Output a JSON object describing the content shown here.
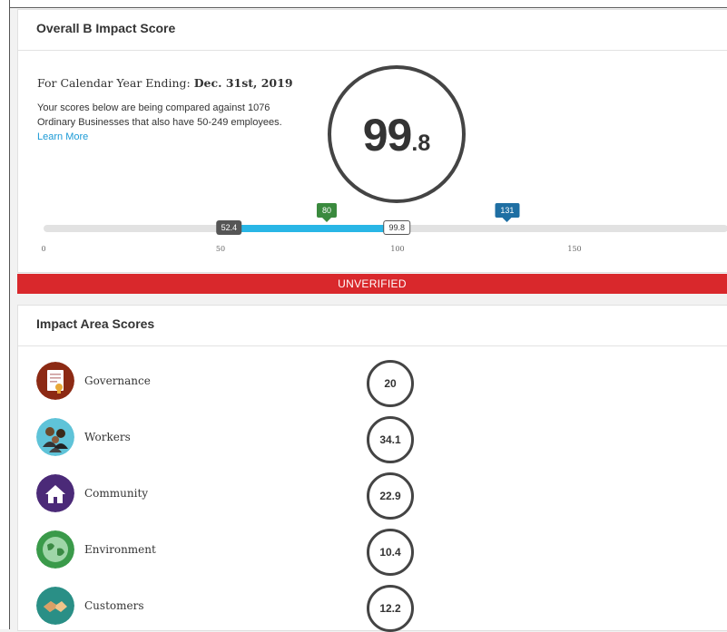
{
  "overall": {
    "title": "Overall B Impact Score",
    "year_prefix": "For Calendar Year Ending: ",
    "year_value": "Dec. 31st, 2019",
    "description": "Your scores below are being compared against 1076 Ordinary Businesses that also have 50-249 employees.",
    "learn_more": "Learn More",
    "score_int": "99",
    "score_dec": ".8"
  },
  "scale": {
    "min": 0,
    "max": 200,
    "fill_from": 52.4,
    "fill_to": 99.8,
    "start_label": "52.4",
    "end_label": "99.8",
    "median_flag": {
      "value": 80,
      "label": "80",
      "color": "#3a8a3e"
    },
    "top_flag": {
      "value": 131,
      "label": "131",
      "color": "#1f6fa3"
    },
    "ticks": [
      "0",
      "50",
      "100",
      "150"
    ],
    "fill_color": "#29b6e6"
  },
  "status_banner": {
    "text": "UNVERIFIED",
    "color": "#d9282c"
  },
  "impact": {
    "title": "Impact Area Scores",
    "areas": [
      {
        "label": "Governance",
        "score": "20",
        "icon": "governance-icon",
        "color": "#8c2a14"
      },
      {
        "label": "Workers",
        "score": "34.1",
        "icon": "workers-icon",
        "color": "#5fc3d8"
      },
      {
        "label": "Community",
        "score": "22.9",
        "icon": "community-icon",
        "color": "#4b2a78"
      },
      {
        "label": "Environment",
        "score": "10.4",
        "icon": "environment-icon",
        "color": "#3a9a4a"
      },
      {
        "label": "Customers",
        "score": "12.2",
        "icon": "customers-icon",
        "color": "#2a8f86"
      }
    ]
  }
}
